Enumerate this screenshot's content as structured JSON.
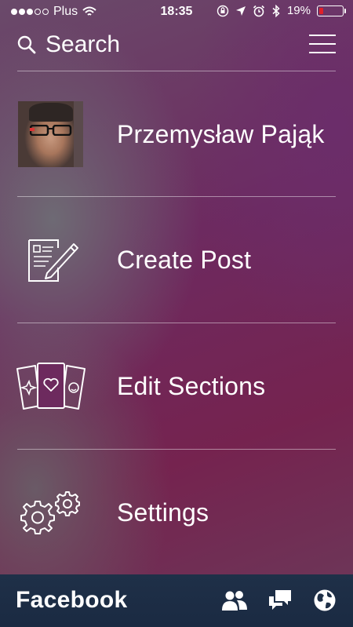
{
  "status_bar": {
    "carrier": "Plus",
    "time": "18:35",
    "battery_percent": "19%",
    "battery_level": 0.19,
    "signal_dots_filled": 3,
    "signal_dots_total": 5,
    "battery_color": "#e0202a"
  },
  "search": {
    "label": "Search",
    "icon": "magnifier-icon",
    "menu_icon": "hamburger-icon"
  },
  "menu": {
    "profile_name": "Przemysław Pająk",
    "create_post": "Create Post",
    "edit_sections": "Edit Sections",
    "settings": "Settings"
  },
  "tab_bar": {
    "brand": "Facebook",
    "icons": [
      "friends-icon",
      "messages-icon",
      "globe-icon"
    ],
    "background": "#1f3048"
  }
}
